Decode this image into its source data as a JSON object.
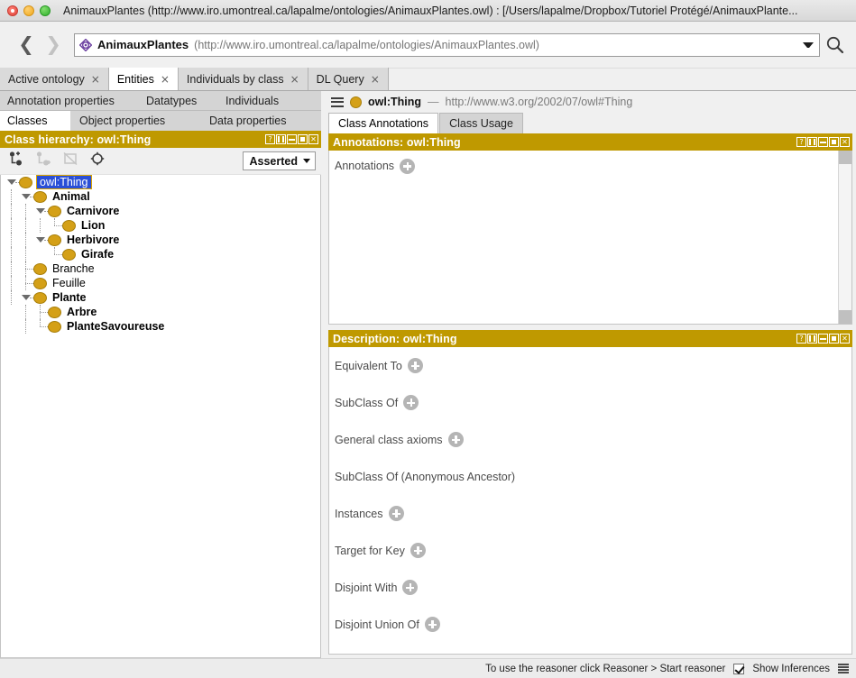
{
  "window": {
    "title": "AnimauxPlantes (http://www.iro.umontreal.ca/lapalme/ontologies/AnimauxPlantes.owl)  : [/Users/lapalme/Dropbox/Tutoriel Protégé/AnimauxPlante...",
    "traffic_lights": [
      "close-red",
      "minimize-yellow",
      "zoom-green"
    ]
  },
  "toolbar": {
    "back_icon": "chevron-left-icon",
    "forward_icon": "chevron-right-icon",
    "ontology_icon": "ontology-diamond-icon",
    "ontology_name": "AnimauxPlantes",
    "ontology_uri": "(http://www.iro.umontreal.ca/lapalme/ontologies/AnimauxPlantes.owl)",
    "dropdown_icon": "chevron-down-icon",
    "search_icon": "search-icon"
  },
  "tabs": [
    {
      "label": "Active ontology",
      "close": "×",
      "active": false
    },
    {
      "label": "Entities",
      "close": "×",
      "active": true
    },
    {
      "label": "Individuals by class",
      "close": "×",
      "active": false
    },
    {
      "label": "DL Query",
      "close": "×",
      "active": false
    }
  ],
  "entity_subtabs_row1": [
    {
      "label": "Annotation properties",
      "active": false
    },
    {
      "label": "Datatypes",
      "active": false
    },
    {
      "label": "Individuals",
      "active": false
    }
  ],
  "entity_subtabs_row2": [
    {
      "label": "Classes",
      "active": true
    },
    {
      "label": "Object properties",
      "active": false
    },
    {
      "label": "Data properties",
      "active": false
    }
  ],
  "class_hierarchy": {
    "header_title": "Class hierarchy: owl:Thing",
    "header_buttons": [
      "help-button",
      "split-button",
      "minimize-button",
      "maximize-button",
      "close-button"
    ],
    "header_button_labels": [
      "?",
      "",
      "",
      "",
      "✕"
    ],
    "tools": [
      {
        "name": "add-subclass-icon",
        "enabled": true
      },
      {
        "name": "add-sibling-class-icon",
        "enabled": false
      },
      {
        "name": "delete-class-icon",
        "enabled": false
      },
      {
        "name": "search-target-icon",
        "enabled": true
      }
    ],
    "view_selector": "Asserted",
    "tree": [
      {
        "label": "owl:Thing",
        "depth": 0,
        "expanded": true,
        "selected": true,
        "bold": false
      },
      {
        "label": "Animal",
        "depth": 1,
        "expanded": true,
        "selected": false,
        "bold": true
      },
      {
        "label": "Carnivore",
        "depth": 2,
        "expanded": true,
        "selected": false,
        "bold": true
      },
      {
        "label": "Lion",
        "depth": 3,
        "expanded": false,
        "selected": false,
        "bold": true
      },
      {
        "label": "Herbivore",
        "depth": 2,
        "expanded": true,
        "selected": false,
        "bold": true
      },
      {
        "label": "Girafe",
        "depth": 3,
        "expanded": false,
        "selected": false,
        "bold": true
      },
      {
        "label": "Branche",
        "depth": 1,
        "expanded": false,
        "selected": false,
        "bold": false
      },
      {
        "label": "Feuille",
        "depth": 1,
        "expanded": false,
        "selected": false,
        "bold": false
      },
      {
        "label": "Plante",
        "depth": 1,
        "expanded": true,
        "selected": false,
        "bold": true
      },
      {
        "label": "Arbre",
        "depth": 2,
        "expanded": false,
        "selected": false,
        "bold": true
      },
      {
        "label": "PlanteSavoureuse",
        "depth": 2,
        "expanded": false,
        "selected": false,
        "bold": true
      }
    ]
  },
  "entity_header": {
    "menu_icon": "hamburger-menu-icon",
    "entity_icon": "class-circle-icon",
    "entity_name": "owl:Thing",
    "separator": "—",
    "entity_uri": "http://www.w3.org/2002/07/owl#Thing"
  },
  "class_tabs": [
    {
      "label": "Class Annotations",
      "active": true
    },
    {
      "label": "Class Usage",
      "active": false
    }
  ],
  "annotations_panel": {
    "header_title": "Annotations: owl:Thing",
    "row_label": "Annotations",
    "add_icon": "add-plus-icon"
  },
  "description_panel": {
    "header_title": "Description: owl:Thing",
    "rows": [
      {
        "label": "Equivalent To",
        "has_add": true
      },
      {
        "label": "SubClass Of",
        "has_add": true
      },
      {
        "label": "General class axioms",
        "has_add": true
      },
      {
        "label": "SubClass Of (Anonymous Ancestor)",
        "has_add": false
      },
      {
        "label": "Instances",
        "has_add": true
      },
      {
        "label": "Target for Key",
        "has_add": true
      },
      {
        "label": "Disjoint With",
        "has_add": true
      },
      {
        "label": "Disjoint Union Of",
        "has_add": true
      }
    ]
  },
  "statusbar": {
    "message": "To use the reasoner click Reasoner > Start reasoner",
    "checkbox_label": "Show Inferences",
    "checkbox_checked": true,
    "list_icon": "list-lines-icon"
  },
  "colors": {
    "gold_header": "#bf9900",
    "class_dot": "#d4a017",
    "selection_blue": "#2a4fd7",
    "ontology_icon_purple": "#6b3fa0"
  }
}
